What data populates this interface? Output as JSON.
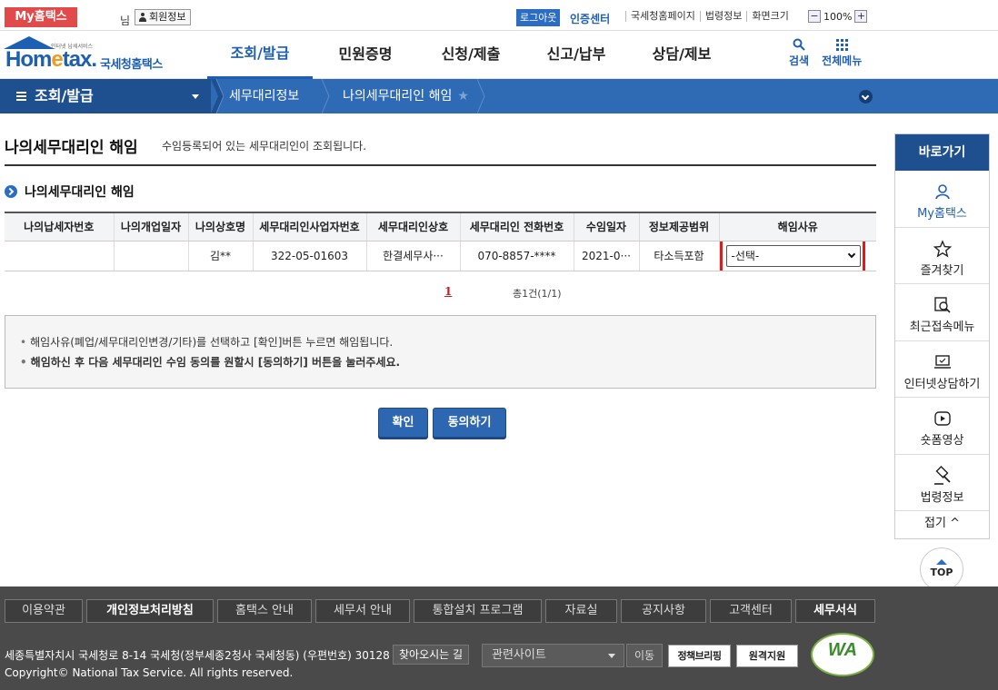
{
  "topbar": {
    "my_hometax": "My홈택스",
    "nim": "님",
    "member_info": "회원정보",
    "logout": "로그아웃",
    "cert_center": "인증센터",
    "links": [
      "국세청홈페이지",
      "법령정보",
      "화면크기"
    ],
    "zoom_minus": "−",
    "zoom_value": "100%",
    "zoom_plus": "+"
  },
  "header": {
    "logo_small": "인터넷 납세서비스",
    "logo_word_a": "Hom",
    "logo_word_b": "e",
    "logo_word_c": "tax.",
    "logo_ko": "국세청홈택스",
    "nav": [
      "조회/발급",
      "민원증명",
      "신청/제출",
      "신고/납부",
      "상담/제보"
    ],
    "search": "검색",
    "all_menu": "전체메뉴"
  },
  "location": {
    "home": "조회/발급",
    "crumb1": "세무대리정보",
    "crumb2": "나의세무대리인 해임",
    "star": "★"
  },
  "page": {
    "title": "나의세무대리인 해임",
    "desc": "수임등록되어 있는 세무대리인이 조회됩니다.",
    "section_title": "나의세무대리인 해임"
  },
  "table": {
    "headers": [
      "나의납세자번호",
      "나의개업일자",
      "나의상호명",
      "세무대리인사업자번호",
      "세무대리인상호",
      "세무대리인 전화번호",
      "수임일자",
      "정보제공범위",
      "해임사유"
    ],
    "rows": [
      [
        "",
        "",
        "김**",
        "322-05-01603",
        "한결세무사···",
        "070-8857-****",
        "2021-0···",
        "타소득포함"
      ]
    ],
    "reason_select": "-선택-"
  },
  "paging": {
    "current": "1",
    "count": "총1건(1/1)"
  },
  "notice": {
    "line1": "해임사유(폐업/세무대리인변경/기타)를 선택하고 [확인]버튼 누르면 해임됩니다.",
    "line2": "해임하신 후 다음 세무대리인 수임 동의를 원할시 [동의하기] 버튼을 눌러주세요."
  },
  "buttons": {
    "confirm": "확인",
    "agree": "동의하기"
  },
  "quick": {
    "title": "바로가기",
    "items": [
      "My홈택스",
      "즐겨찾기",
      "최근접속메뉴",
      "인터넷상담하기",
      "숏폼영상",
      "법령정보"
    ],
    "fold": "접기 ^",
    "top": "TOP"
  },
  "footer": {
    "nav": [
      "이용약관",
      "개인정보처리방침",
      "홈택스 안내",
      "세무서 안내",
      "통합설치 프로그램",
      "자료실",
      "공지사항",
      "고객센터",
      "세무서식"
    ],
    "address": "세종특별자치시 국세청로 8-14 국세청(정부세종2청사 국세청동) (우편번호) 30128",
    "find_way": "찾아오시는 길",
    "copyright": "Copyright© National Tax Service. All rights reserved.",
    "related_sites": "관련사이트",
    "move": "이동",
    "badge_policy": "정책브리핑",
    "badge_remote": "원격지원",
    "wa_mark": "WA"
  }
}
